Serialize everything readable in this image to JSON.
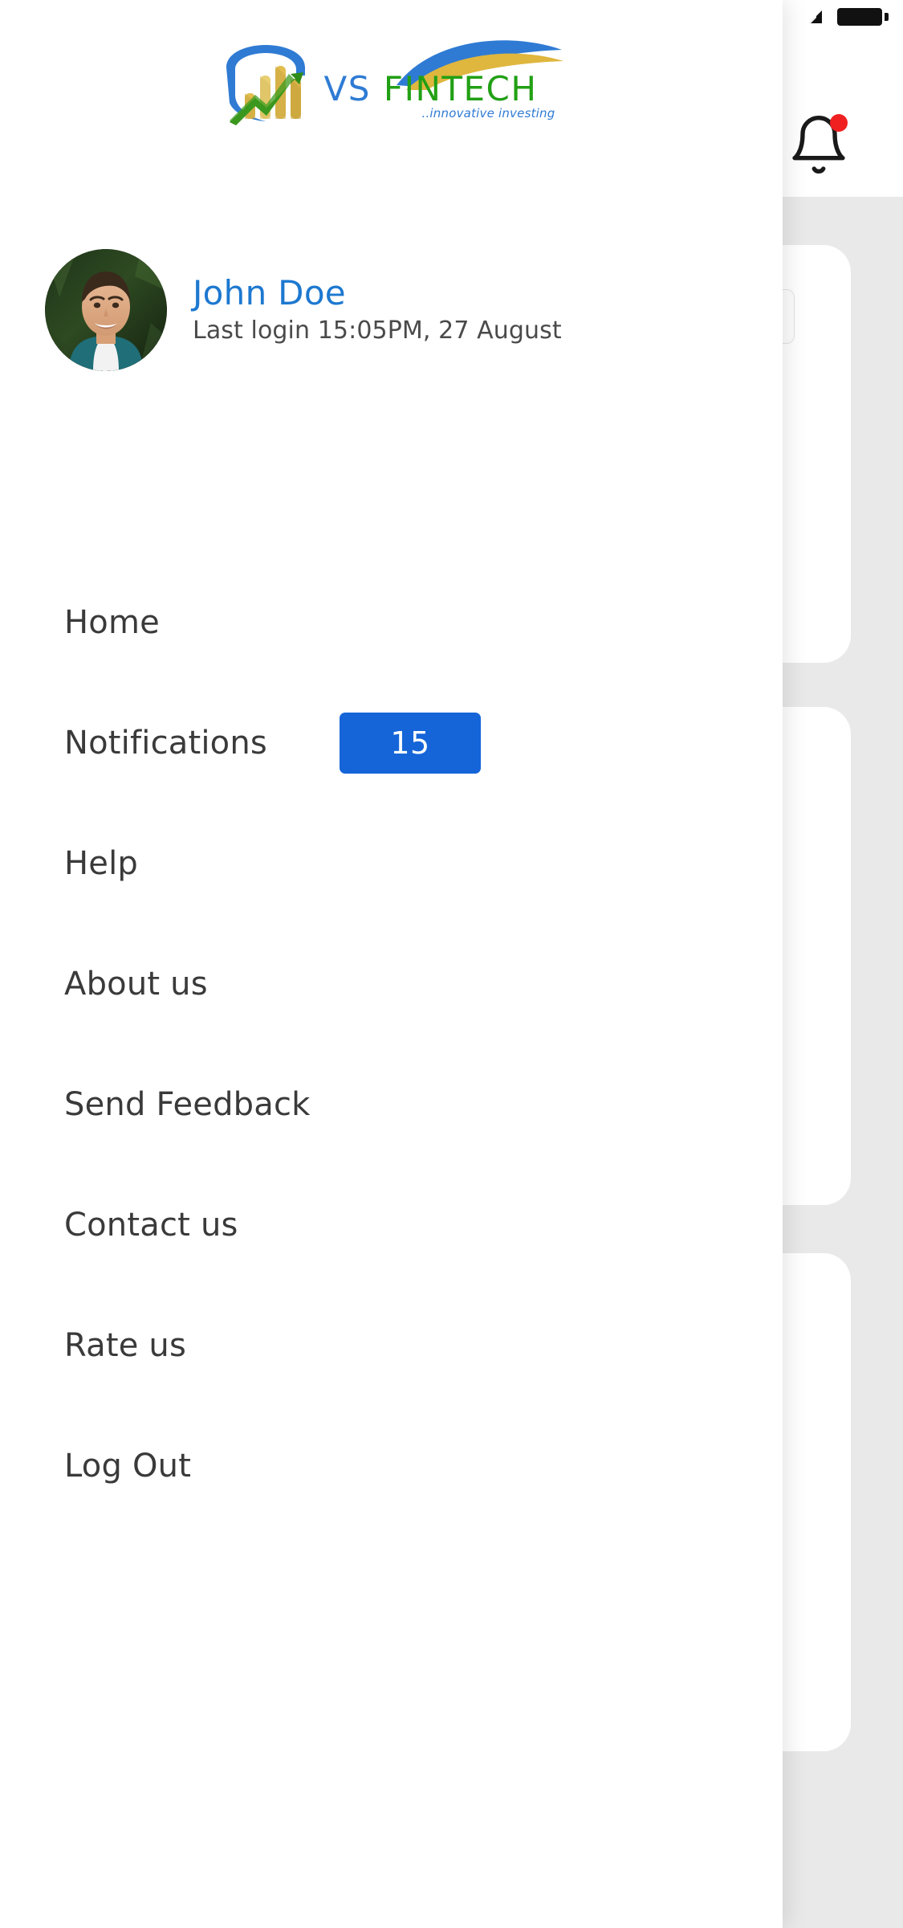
{
  "statusbar": {
    "wifi_icon": "wifi-signal-icon",
    "battery_icon": "battery-full-icon"
  },
  "header": {
    "logo_mark_icon": "shield-bar-chart-arrow-icon",
    "brand_prefix": "VS",
    "brand_name": "FINTECH",
    "tagline": "..innovative investing",
    "brand_prefix_color": "#2f7bd4",
    "brand_name_color": "#22a015",
    "tagline_color": "#2f7bd4",
    "notification_bell_icon": "bell-icon",
    "notification_dot_color": "#f02020"
  },
  "profile": {
    "avatar_icon": "user-avatar-photo",
    "name": "John Doe",
    "name_color": "#1d78d0",
    "last_login": "Last login 15:05PM, 27 August"
  },
  "menu": {
    "items": [
      {
        "label": "Home",
        "badge": null
      },
      {
        "label": "Notifications",
        "badge": "15"
      },
      {
        "label": "Help",
        "badge": null
      },
      {
        "label": "About us",
        "badge": null
      },
      {
        "label": "Send Feedback",
        "badge": null
      },
      {
        "label": "Contact us",
        "badge": null
      },
      {
        "label": "Rate us",
        "badge": null
      },
      {
        "label": "Log Out",
        "badge": null
      }
    ],
    "badge_color": "#1565d8"
  },
  "background": {
    "dim_color": "#e9e9e9",
    "card_color": "#ffffff",
    "peek_text": ")"
  }
}
